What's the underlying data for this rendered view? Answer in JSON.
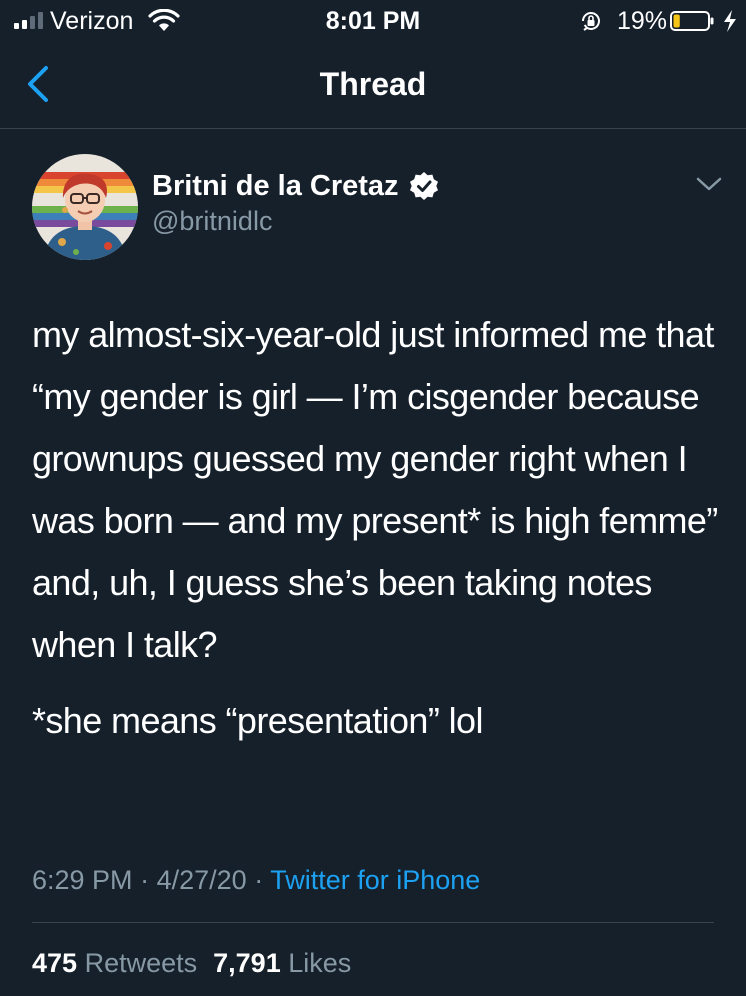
{
  "status_bar": {
    "carrier": "Verizon",
    "time": "8:01 PM",
    "battery_percent": "19%",
    "battery_level": 0.19,
    "battery_color": "#f5c518"
  },
  "nav": {
    "title": "Thread",
    "back_icon": "chevron-left-icon"
  },
  "tweet": {
    "author_name": "Britni de la Cretaz",
    "author_handle": "@britnidlc",
    "verified": true,
    "text_paragraph_1": "my almost-six-year-old just informed me that “my gender is girl — I’m cisgender because grownups guessed my gender right when I was born — and my present* is high femme” and, uh, I guess she’s been taking notes when I talk?",
    "text_paragraph_2": "*she means “presentation” lol",
    "time": "6:29 PM",
    "date": "4/27/20",
    "separator": "·",
    "source": "Twitter for iPhone",
    "retweets_count": "475",
    "retweets_label": "Retweets",
    "likes_count": "7,791",
    "likes_label": "Likes"
  },
  "colors": {
    "background": "#15202b",
    "accent": "#1da1f2",
    "secondary_text": "#8899a6",
    "divider": "#38444d"
  }
}
